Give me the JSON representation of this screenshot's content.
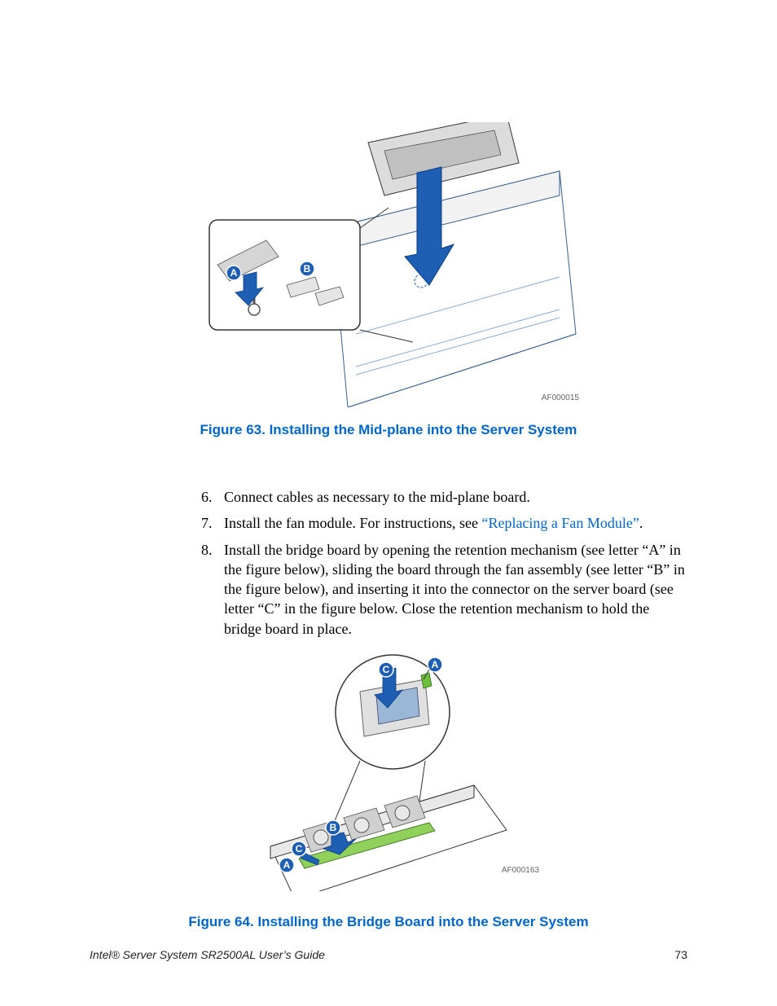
{
  "figure63": {
    "caption": "Figure 63. Installing the Mid-plane into the Server System",
    "id_label": "AF000015",
    "callouts": {
      "a": "A",
      "b": "B"
    }
  },
  "steps": {
    "start": 6,
    "items": [
      {
        "text_before": "Connect cables as necessary to the mid-plane board.",
        "link": "",
        "text_after": ""
      },
      {
        "text_before": "Install the fan module. For instructions, see ",
        "link": "“Replacing a Fan Module”",
        "text_after": "."
      },
      {
        "text_before": "Install the bridge board by opening the retention mechanism (see letter “A” in the figure below), sliding the board through the fan assembly (see letter “B” in the figure below), and inserting it into the connector on the server board (see letter “C” in the figure below. Close the retention mechanism to hold the bridge board in place.",
        "link": "",
        "text_after": ""
      }
    ]
  },
  "figure64": {
    "caption": "Figure 64. Installing the Bridge Board into the Server System",
    "id_label": "AF000163",
    "callouts": {
      "a": "A",
      "b": "B",
      "c": "C"
    }
  },
  "footer": {
    "title": "Intel® Server System SR2500AL User’s Guide",
    "page_number": "73"
  }
}
